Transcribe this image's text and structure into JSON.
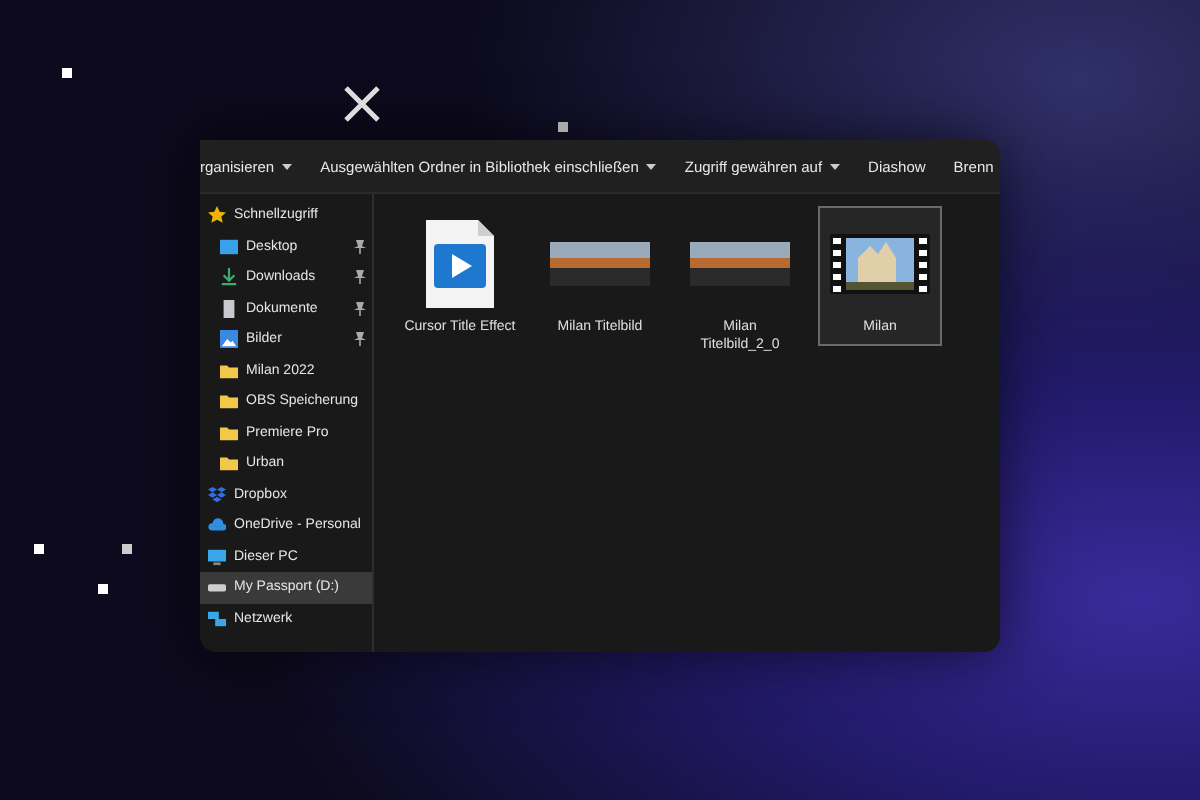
{
  "toolbar": [
    {
      "label": "rganisieren",
      "dropdown": true
    },
    {
      "label": "Ausgewählten Ordner in Bibliothek einschließen",
      "dropdown": true
    },
    {
      "label": "Zugriff gewähren auf",
      "dropdown": true
    },
    {
      "label": "Diashow",
      "dropdown": false
    },
    {
      "label": "Brenn",
      "dropdown": false
    }
  ],
  "sidebar": {
    "items": [
      {
        "label": "Schnellzugriff",
        "kind": "star",
        "pinned": false,
        "selected": false,
        "children": [
          {
            "label": "Desktop",
            "kind": "desktop",
            "pinned": true,
            "selected": false
          },
          {
            "label": "Downloads",
            "kind": "download",
            "pinned": true,
            "selected": false
          },
          {
            "label": "Dokumente",
            "kind": "document",
            "pinned": true,
            "selected": false
          },
          {
            "label": "Bilder",
            "kind": "pictures",
            "pinned": true,
            "selected": false
          },
          {
            "label": "Milan 2022",
            "kind": "folder",
            "pinned": false,
            "selected": false
          },
          {
            "label": "OBS Speicherung",
            "kind": "folder",
            "pinned": false,
            "selected": false
          },
          {
            "label": "Premiere Pro",
            "kind": "folder",
            "pinned": false,
            "selected": false
          },
          {
            "label": "Urban",
            "kind": "folder",
            "pinned": false,
            "selected": false
          }
        ]
      },
      {
        "label": "Dropbox",
        "kind": "dropbox",
        "pinned": false,
        "selected": false
      },
      {
        "label": "OneDrive - Personal",
        "kind": "cloud",
        "pinned": false,
        "selected": false
      },
      {
        "label": "Dieser PC",
        "kind": "pc",
        "pinned": false,
        "selected": false
      },
      {
        "label": "My Passport (D:)",
        "kind": "drive",
        "pinned": false,
        "selected": true
      },
      {
        "label": "Netzwerk",
        "kind": "network",
        "pinned": false,
        "selected": false
      }
    ]
  },
  "files": [
    {
      "name": "Cursor Title Effect",
      "kind": "media-file",
      "selected": false
    },
    {
      "name": "Milan Titelbild",
      "kind": "thumbnail",
      "selected": false
    },
    {
      "name": "Milan Titelbild_2_0",
      "kind": "thumbnail",
      "selected": false
    },
    {
      "name": "Milan",
      "kind": "film",
      "selected": true
    }
  ]
}
